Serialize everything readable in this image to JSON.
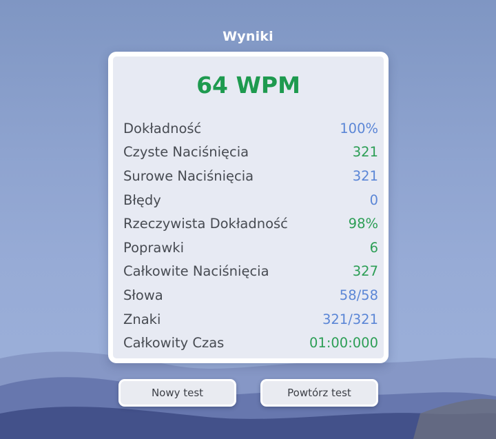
{
  "header": {
    "title": "Wyniki"
  },
  "results": {
    "wpm": "64 WPM",
    "stats": [
      {
        "label": "Dokładność",
        "value": "100%",
        "color": "blue"
      },
      {
        "label": "Czyste Naciśnięcia",
        "value": "321",
        "color": "green"
      },
      {
        "label": "Surowe Naciśnięcia",
        "value": "321",
        "color": "blue"
      },
      {
        "label": "Błędy",
        "value": "0",
        "color": "blue"
      },
      {
        "label": "Rzeczywista Dokładność",
        "value": "98%",
        "color": "green"
      },
      {
        "label": "Poprawki",
        "value": "6",
        "color": "green"
      },
      {
        "label": "Całkowite Naciśnięcia",
        "value": "327",
        "color": "green"
      },
      {
        "label": "Słowa",
        "value": "58/58",
        "color": "blue"
      },
      {
        "label": "Znaki",
        "value": "321/321",
        "color": "blue"
      },
      {
        "label": "Całkowity Czas",
        "value": "01:00:000",
        "color": "green"
      }
    ]
  },
  "actions": {
    "new_test_label": "Nowy test",
    "retry_label": "Powtórz test"
  },
  "colors": {
    "wpm": "#1e9a4f",
    "blue": "#5b86d6",
    "green": "#2c9e55"
  }
}
